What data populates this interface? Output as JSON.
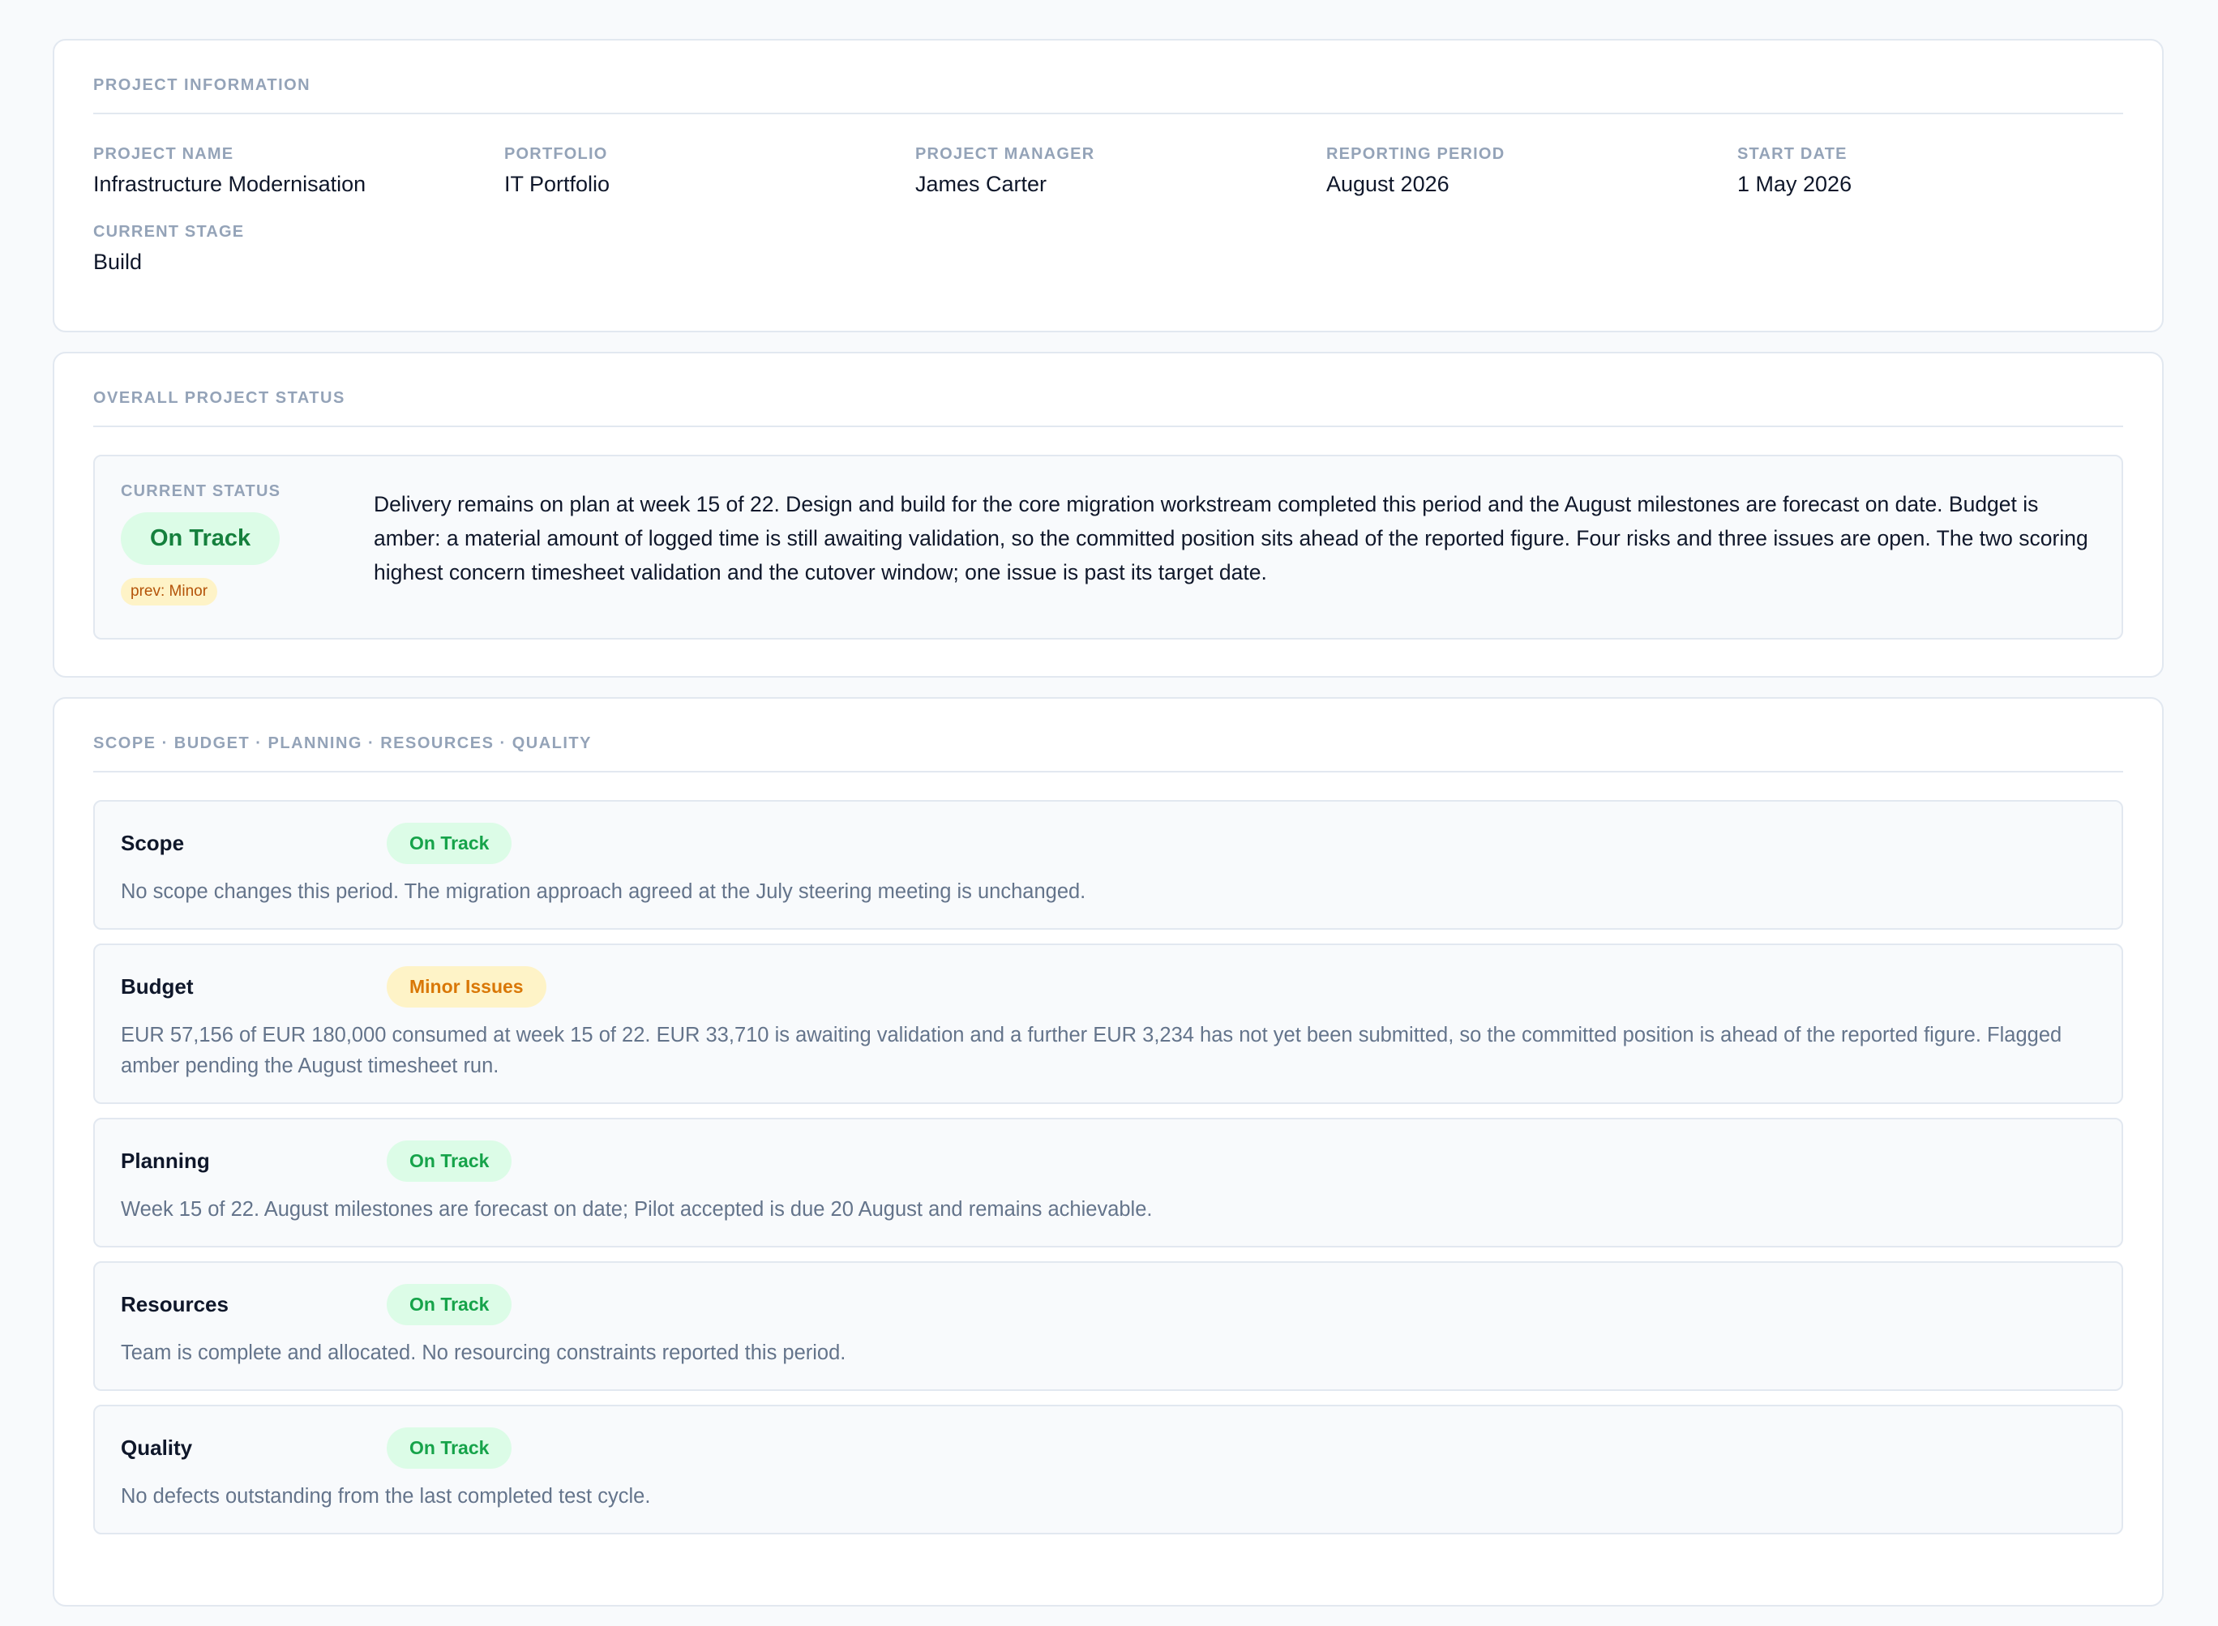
{
  "project_info": {
    "title": "PROJECT INFORMATION",
    "fields": [
      {
        "label": "PROJECT NAME",
        "value": "Infrastructure Modernisation"
      },
      {
        "label": "PORTFOLIO",
        "value": "IT Portfolio"
      },
      {
        "label": "PROJECT MANAGER",
        "value": "James Carter"
      },
      {
        "label": "REPORTING PERIOD",
        "value": "August 2026"
      },
      {
        "label": "START DATE",
        "value": "1 May 2026"
      },
      {
        "label": "CURRENT STAGE",
        "value": "Build"
      }
    ]
  },
  "overall": {
    "title": "OVERALL PROJECT STATUS",
    "status_label": "CURRENT STATUS",
    "status": "On Track",
    "previous": "prev: Minor",
    "summary": "Delivery remains on plan at week 15 of 22. Design and build for the core migration workstream completed this period and the August milestones are forecast on date. Budget is amber: a material amount of logged time is still awaiting validation, so the committed position sits ahead of the reported figure. Four risks and three issues are open. The two scoring highest concern timesheet validation and the cutover window; one issue is past its target date."
  },
  "dimensions": {
    "title": "SCOPE · BUDGET · PLANNING · RESOURCES · QUALITY",
    "items": [
      {
        "name": "Scope",
        "status": "On Track",
        "description": "No scope changes this period. The migration approach agreed at the July steering meeting is unchanged."
      },
      {
        "name": "Budget",
        "status": "Minor Issues",
        "description": "EUR 57,156 of EUR 180,000 consumed at week 15 of 22. EUR 33,710 is awaiting validation and a further EUR 3,234 has not yet been submitted, so the committed position is ahead of the reported figure. Flagged amber pending the August timesheet run."
      },
      {
        "name": "Planning",
        "status": "On Track",
        "description": "Week 15 of 22. August milestones are forecast on date; Pilot accepted is due 20 August and remains achievable."
      },
      {
        "name": "Resources",
        "status": "On Track",
        "description": "Team is complete and allocated. No resourcing constraints reported this period."
      },
      {
        "name": "Quality",
        "status": "On Track",
        "description": "No defects outstanding from the last completed test cycle."
      }
    ]
  },
  "colors": {
    "on_track_bg": "#dcfce7",
    "on_track_text": "#16a34a",
    "minor_bg": "#fef3c7",
    "minor_text": "#d97706"
  }
}
